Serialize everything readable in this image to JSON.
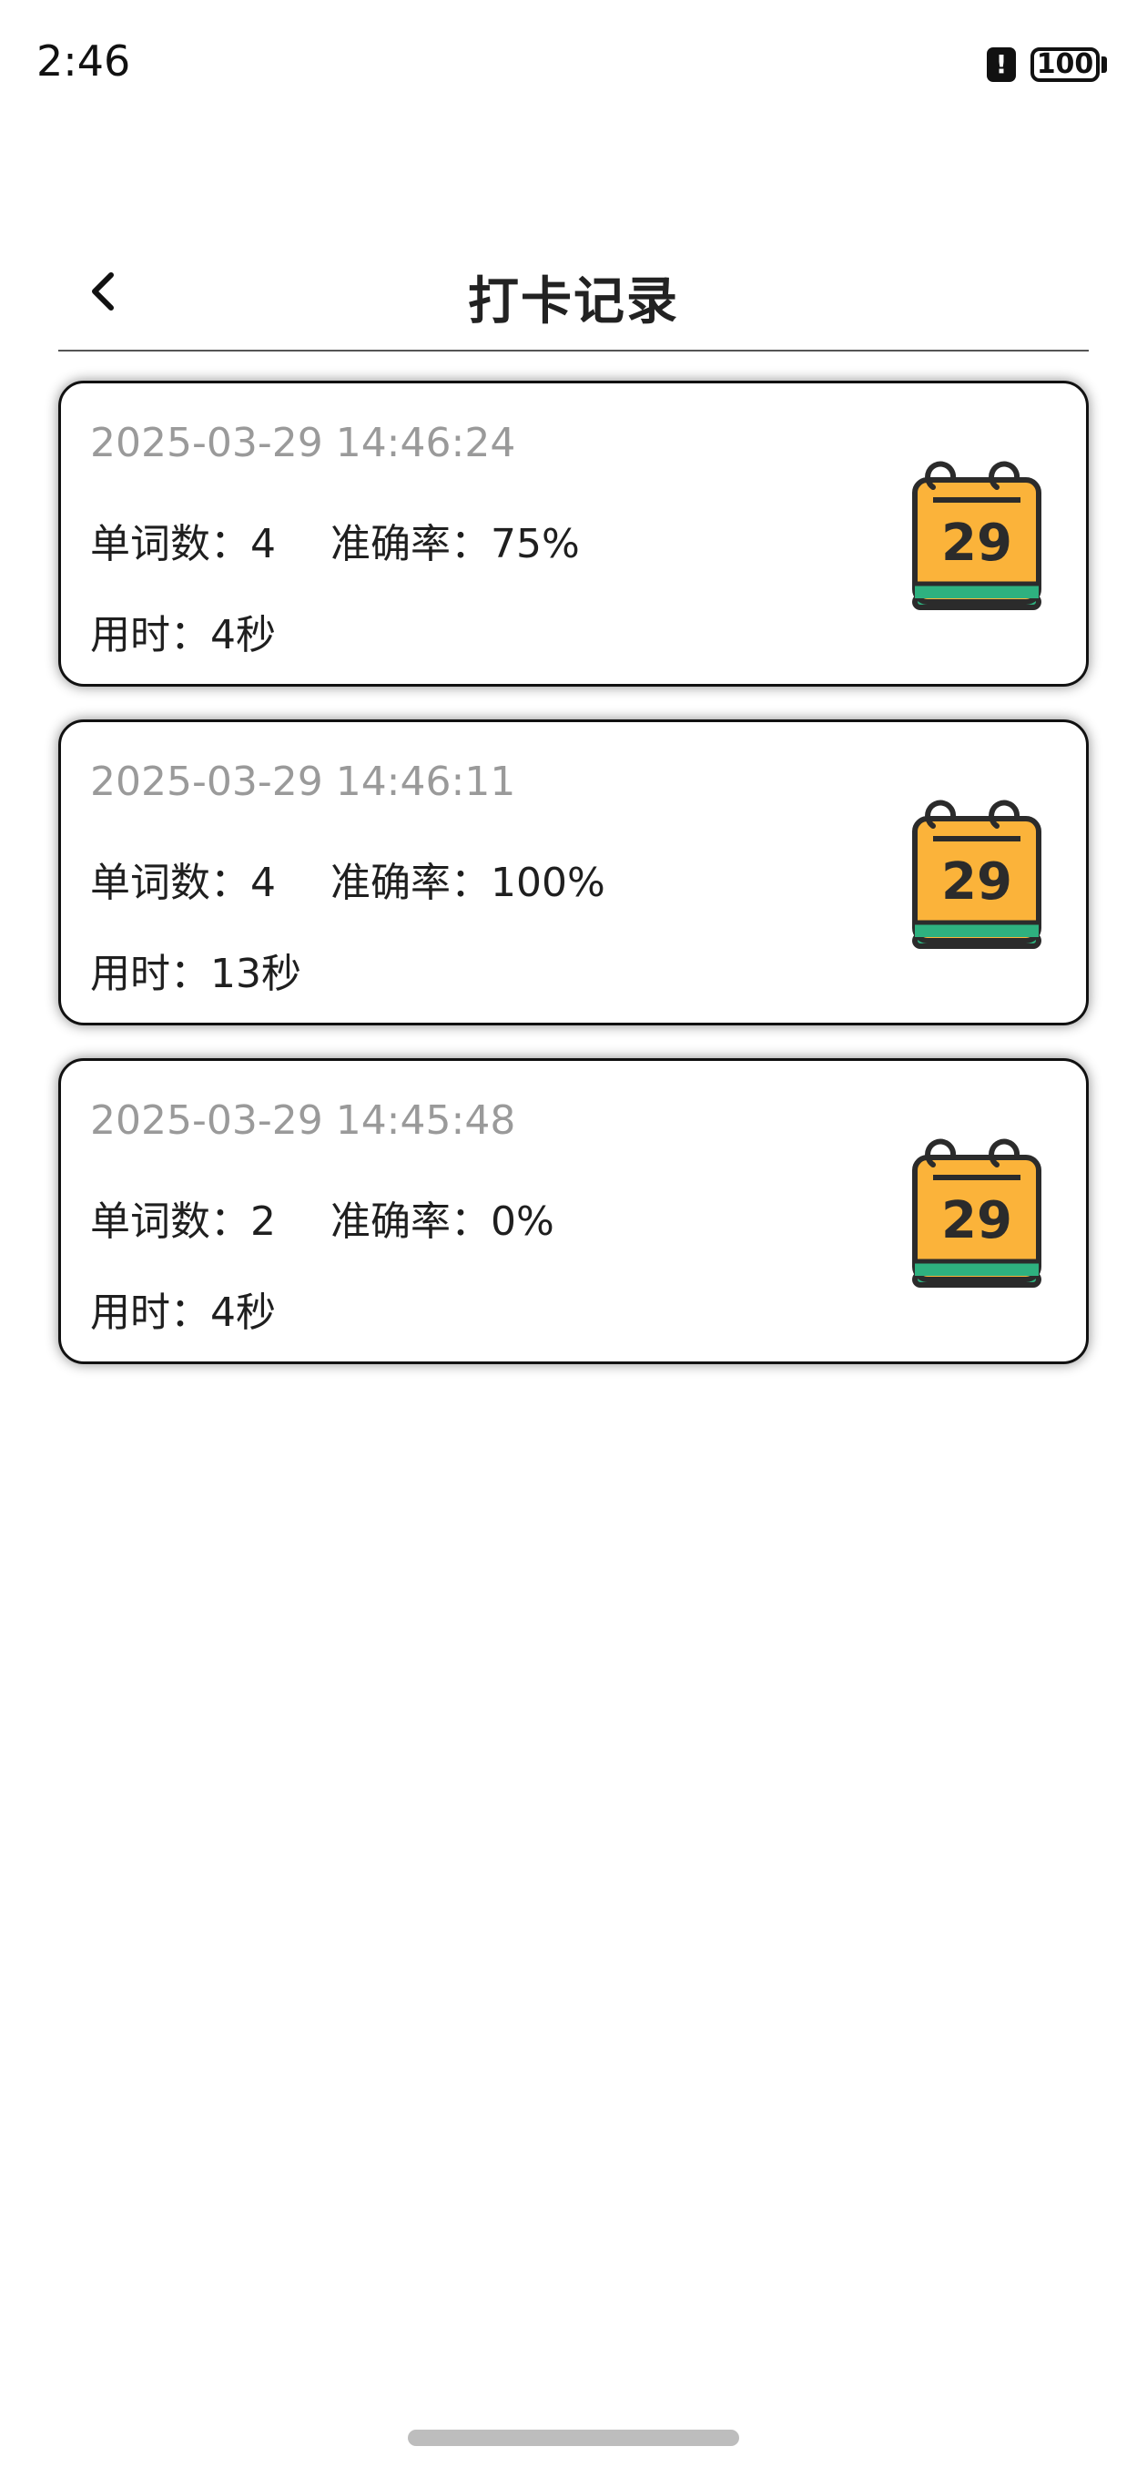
{
  "status_bar": {
    "time": "2:46",
    "alert_glyph": "!",
    "battery": "100"
  },
  "header": {
    "title": "打卡记录",
    "back_icon": "chevron-left-icon"
  },
  "records": [
    {
      "timestamp": "2025-03-29 14:46:24",
      "words": "单词数：4",
      "accuracy": "准确率：75%",
      "duration": "用时：4秒",
      "calendar_day": "29"
    },
    {
      "timestamp": "2025-03-29 14:46:11",
      "words": "单词数：4",
      "accuracy": "准确率：100%",
      "duration": "用时：13秒",
      "calendar_day": "29"
    },
    {
      "timestamp": "2025-03-29 14:45:48",
      "words": "单词数：2",
      "accuracy": "准确率：0%",
      "duration": "用时：4秒",
      "calendar_day": "29"
    }
  ],
  "colors": {
    "calendar_body": "#FBB33A",
    "calendar_base": "#2EB17F",
    "outline": "#2B2B2B",
    "timestamp_text": "#9A9A9A"
  }
}
